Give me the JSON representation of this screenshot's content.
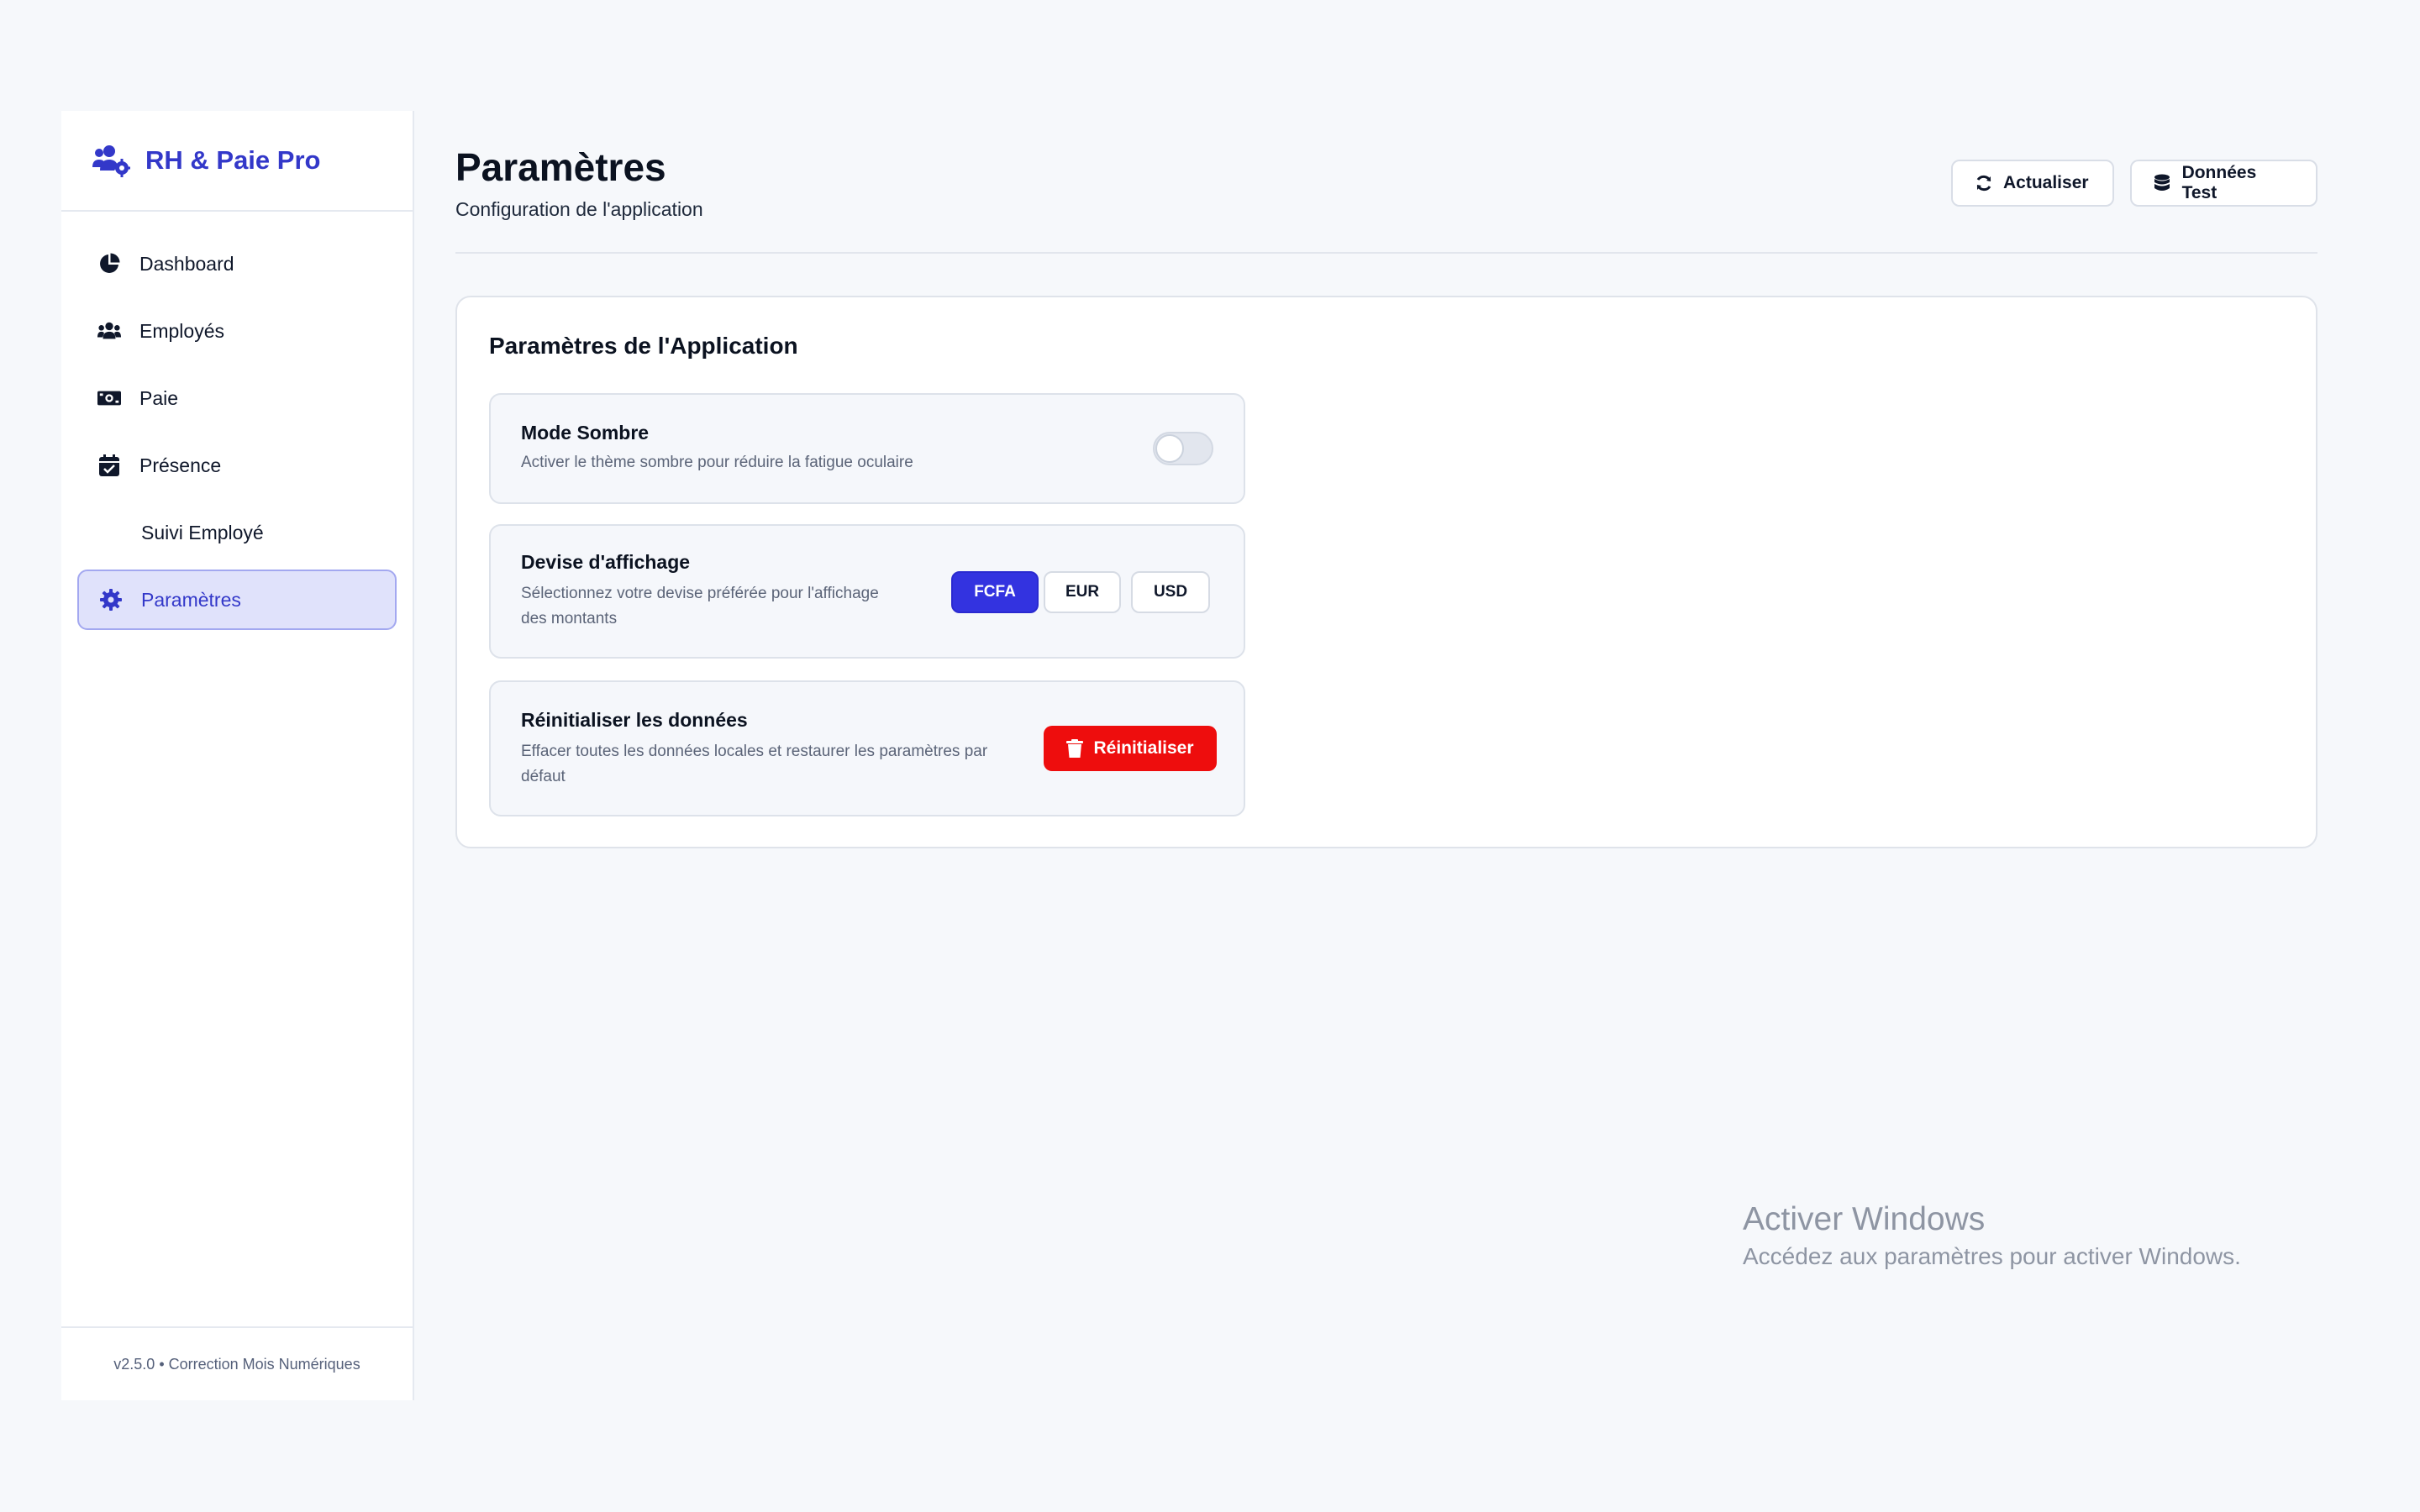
{
  "brand": {
    "name": "RH & Paie Pro",
    "icon": "users-gear-icon"
  },
  "sidebar": {
    "items": [
      {
        "label": "Dashboard",
        "icon": "pie-chart-icon",
        "active": false
      },
      {
        "label": "Employés",
        "icon": "users-icon",
        "active": false
      },
      {
        "label": "Paie",
        "icon": "money-bill-icon",
        "active": false
      },
      {
        "label": "Présence",
        "icon": "calendar-check-icon",
        "active": false
      },
      {
        "label": "Suivi Employé",
        "icon": "",
        "active": false
      },
      {
        "label": "Paramètres",
        "icon": "gear-icon",
        "active": true
      }
    ],
    "footer": "v2.5.0 • Correction Mois Numériques"
  },
  "header": {
    "title": "Paramètres",
    "subtitle": "Configuration de l'application",
    "refresh_label": "Actualiser",
    "refresh_icon": "refresh-icon",
    "testdata_label": "Données Test",
    "testdata_icon": "database-icon"
  },
  "settings": {
    "card_title": "Paramètres de l'Application",
    "dark_mode": {
      "title": "Mode Sombre",
      "description": "Activer le thème sombre pour réduire la fatigue oculaire",
      "enabled": false
    },
    "currency": {
      "title": "Devise d'affichage",
      "description_line1": "Sélectionnez votre devise préférée pour l'affichage",
      "description_line2": "des montants",
      "options": [
        "FCFA",
        "EUR",
        "USD"
      ],
      "selected": "FCFA"
    },
    "reset": {
      "title": "Réinitialiser les données",
      "description_line1": "Effacer toutes les données locales et restaurer les paramètres par",
      "description_line2": "défaut",
      "button_label": "Réinitialiser",
      "button_icon": "trash-icon"
    }
  },
  "watermark": {
    "title": "Activer Windows",
    "subtitle": "Accédez aux paramètres pour activer Windows."
  },
  "colors": {
    "accent": "#3338c9",
    "primary_button": "#3333e0",
    "danger": "#ee0d0d",
    "active_nav_bg": "#e0e2fb"
  }
}
